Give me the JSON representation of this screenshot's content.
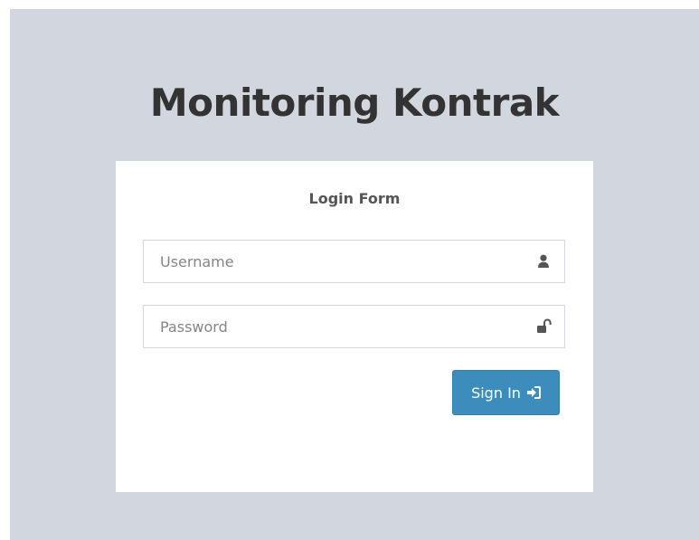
{
  "app": {
    "title": "Monitoring Kontrak"
  },
  "login_form": {
    "heading": "Login Form",
    "username": {
      "value": "",
      "placeholder": "Username",
      "icon": "user-icon"
    },
    "password": {
      "value": "",
      "placeholder": "Password",
      "icon": "unlock-icon"
    },
    "submit": {
      "label": "Sign In",
      "icon": "sign-in-icon"
    }
  },
  "colors": {
    "background": "#d2d6de",
    "box": "#ffffff",
    "primary_button": "#3c8dbc",
    "title_text": "#333333"
  }
}
